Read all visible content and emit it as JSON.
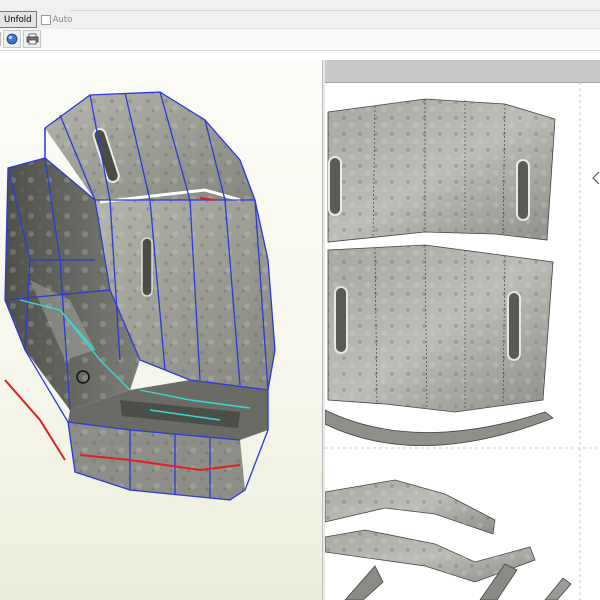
{
  "toolbar": {
    "unfold_label": "Unfold",
    "auto_label": "Auto",
    "auto_checked": false,
    "icons": [
      "view-3d-icon",
      "print-icon"
    ]
  },
  "colors": {
    "edge_blue": "#2a3ad8",
    "edge_cyan": "#3bd6d6",
    "edge_red": "#e02020",
    "viewport_bg": "#f7f7ee",
    "pattern_header": "#c9c9c9"
  }
}
